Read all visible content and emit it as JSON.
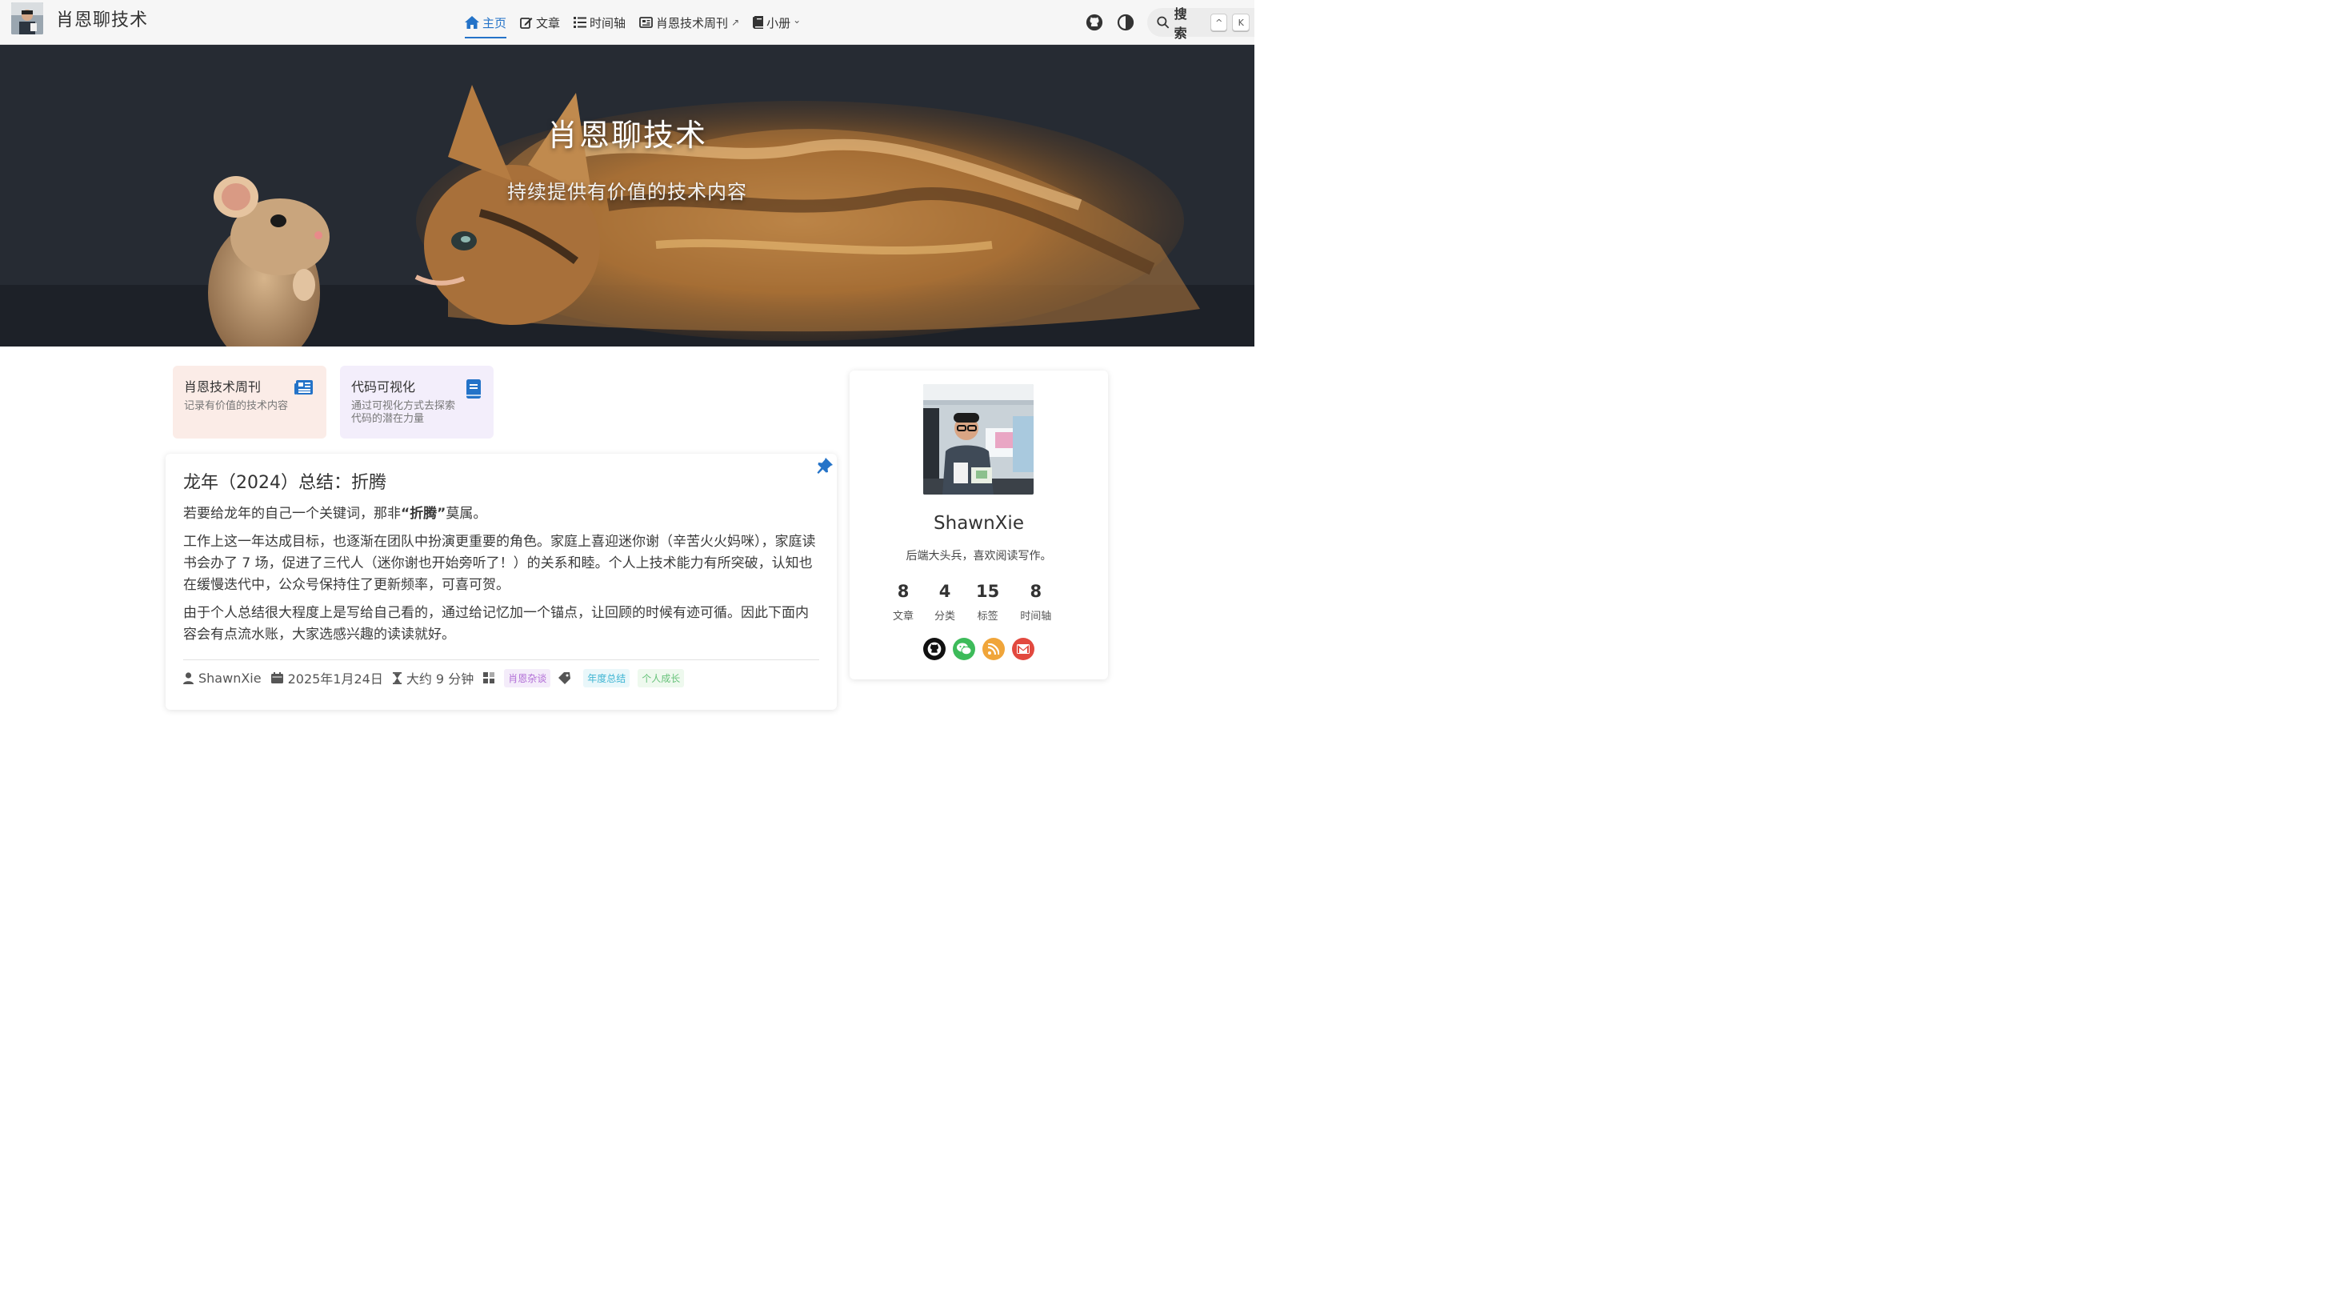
{
  "site": {
    "name": "肖恩聊技术"
  },
  "nav": {
    "items": [
      {
        "label": "主页",
        "icon": "home-icon",
        "active": true
      },
      {
        "label": "文章",
        "icon": "edit-icon"
      },
      {
        "label": "时间轴",
        "icon": "list-icon"
      },
      {
        "label": "肖恩技术周刊",
        "icon": "newspaper-icon",
        "suffix": "↗"
      },
      {
        "label": "小册",
        "icon": "book-icon",
        "suffix": "⌄"
      }
    ]
  },
  "search": {
    "label": "搜索",
    "key1": "^",
    "key2": "K"
  },
  "hero": {
    "title": "肖恩聊技术",
    "subtitle": "持续提供有价值的技术内容"
  },
  "features": [
    {
      "title": "肖恩技术周刊",
      "desc": "记录有价值的技术内容",
      "color": "#fbece7",
      "icon_color": "#2473c8"
    },
    {
      "title": "代码可视化",
      "desc": "通过可视化方式去探索代码的潜在力量",
      "color": "#f3eefb",
      "icon_color": "#2473c8"
    }
  ],
  "article": {
    "title": "龙年（2024）总结：折腾",
    "p1_pre": "若要给龙年的自己一个关键词，那非",
    "p1_bold": "“折腾”",
    "p1_post": "莫属。",
    "p2": "工作上这一年达成目标，也逐渐在团队中扮演更重要的角色。家庭上喜迎迷你谢（辛苦火火妈咪），家庭读书会办了 7 场，促进了三代人（迷你谢也开始旁听了！）的关系和睦。个人上技术能力有所突破，认知也在缓慢迭代中，公众号保持住了更新频率，可喜可贺。",
    "p3": "由于个人总结很大程度上是写给自己看的，通过给记忆加一个锚点，让回顾的时候有迹可循。因此下面内容会有点流水账，大家选感兴趣的读读就好。",
    "meta": {
      "author": "ShawnXie",
      "date": "2025年1月24日",
      "reading_time": "大约 9 分钟",
      "category": "肖恩杂谈",
      "tags": [
        "年度总结",
        "个人成长"
      ]
    }
  },
  "profile": {
    "name": "ShawnXie",
    "bio": "后端大头兵，喜欢阅读写作。",
    "stats": [
      {
        "num": "8",
        "label": "文章"
      },
      {
        "num": "4",
        "label": "分类"
      },
      {
        "num": "15",
        "label": "标签"
      },
      {
        "num": "8",
        "label": "时间轴"
      }
    ],
    "socials": [
      {
        "name": "github-icon",
        "color": "#111111"
      },
      {
        "name": "wechat-icon",
        "color": "#3dbb5a"
      },
      {
        "name": "rss-icon",
        "color": "#f0a53a"
      },
      {
        "name": "gmail-icon",
        "color": "#e2493f"
      }
    ]
  },
  "colors": {
    "accent": "#2473c8"
  }
}
